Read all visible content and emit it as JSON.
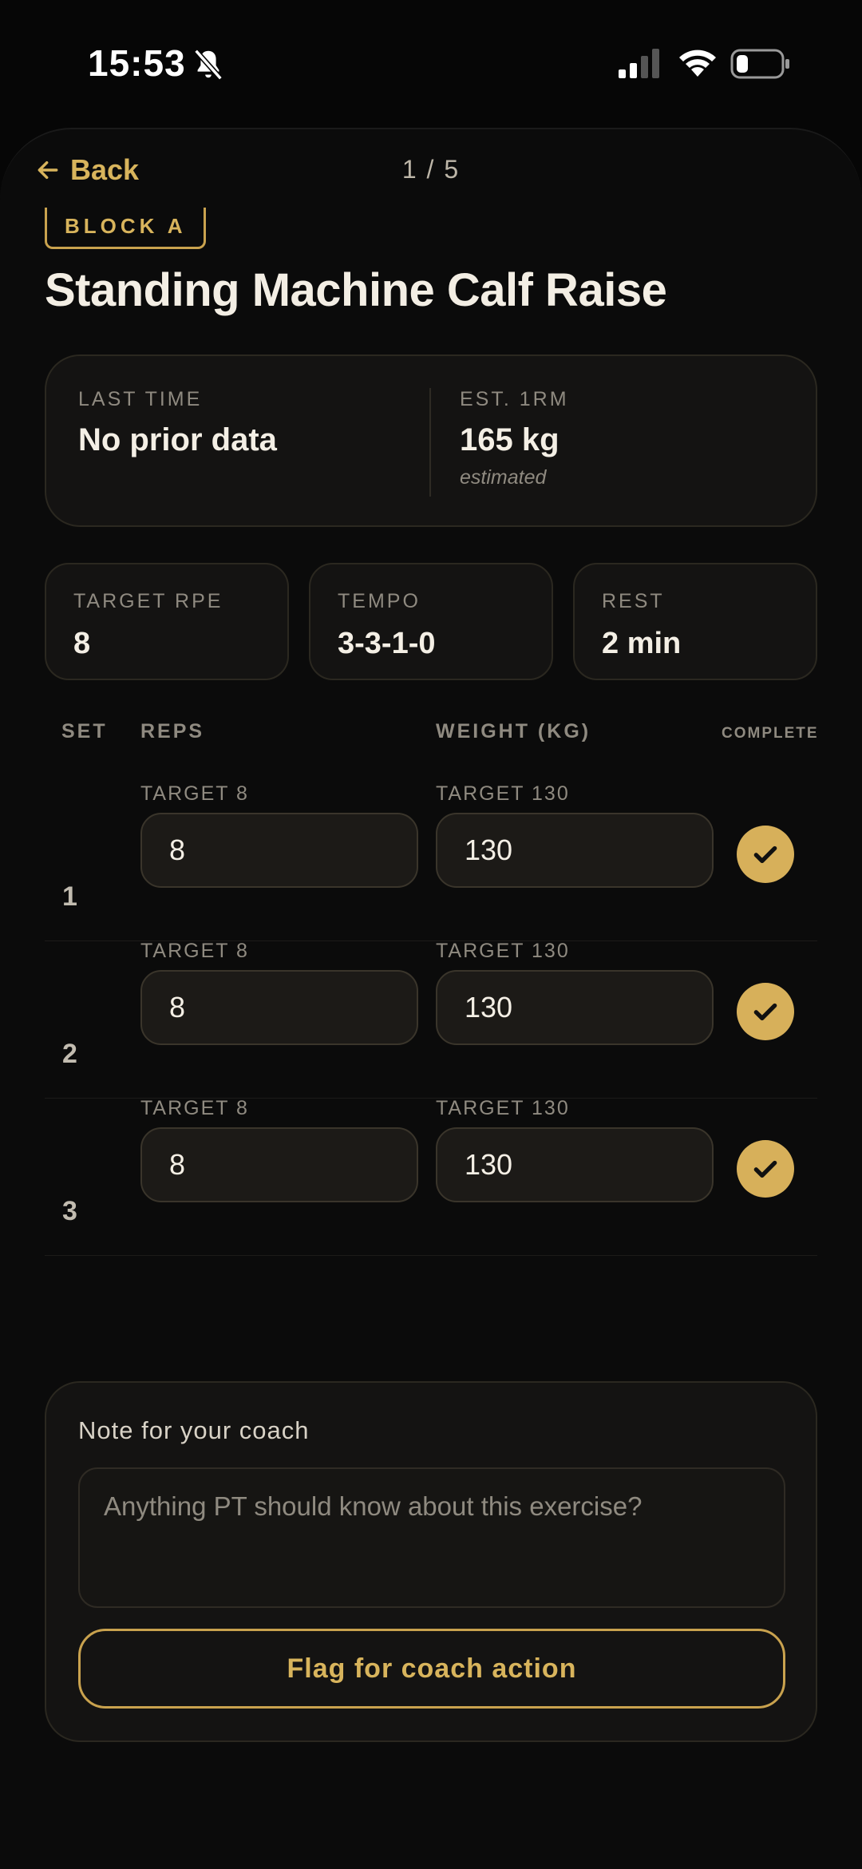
{
  "status_bar": {
    "time": "15:53",
    "icons": [
      "bell-slash-icon",
      "signal-icon",
      "wifi-icon",
      "battery-icon"
    ]
  },
  "nav": {
    "back_label": "Back",
    "position": "1 / 5"
  },
  "exercise": {
    "block": "BLOCK A",
    "title": "Standing Machine Calf Raise"
  },
  "history": {
    "last_time_label": "LAST TIME",
    "last_time_value": "No prior data",
    "est_label": "EST. 1RM",
    "est_value": "165 kg",
    "est_note": "estimated"
  },
  "stats": [
    {
      "label": "TARGET RPE",
      "value": "8"
    },
    {
      "label": "TEMPO",
      "value": "3-3-1-0"
    },
    {
      "label": "REST",
      "value": "2 min"
    }
  ],
  "table_headers": {
    "set": "SET",
    "reps": "REPS",
    "weight": "WEIGHT (KG)",
    "complete": "COMPLETE"
  },
  "sets": [
    {
      "num": "1",
      "reps_target": "TARGET 8",
      "reps": "8",
      "weight_target": "TARGET 130",
      "weight": "130",
      "complete": true
    },
    {
      "num": "2",
      "reps_target": "TARGET 8",
      "reps": "8",
      "weight_target": "TARGET 130",
      "weight": "130",
      "complete": true
    },
    {
      "num": "3",
      "reps_target": "TARGET 8",
      "reps": "8",
      "weight_target": "TARGET 130",
      "weight": "130",
      "complete": true
    }
  ],
  "note": {
    "label": "Note for your coach",
    "placeholder": "Anything PT should know about this exercise?",
    "value": "",
    "flag_button": "Flag for coach action"
  },
  "pager": {
    "total": 5,
    "current": 1
  },
  "colors": {
    "accent": "#d8b45c",
    "background": "#0b0b0b",
    "card": "#141312"
  }
}
